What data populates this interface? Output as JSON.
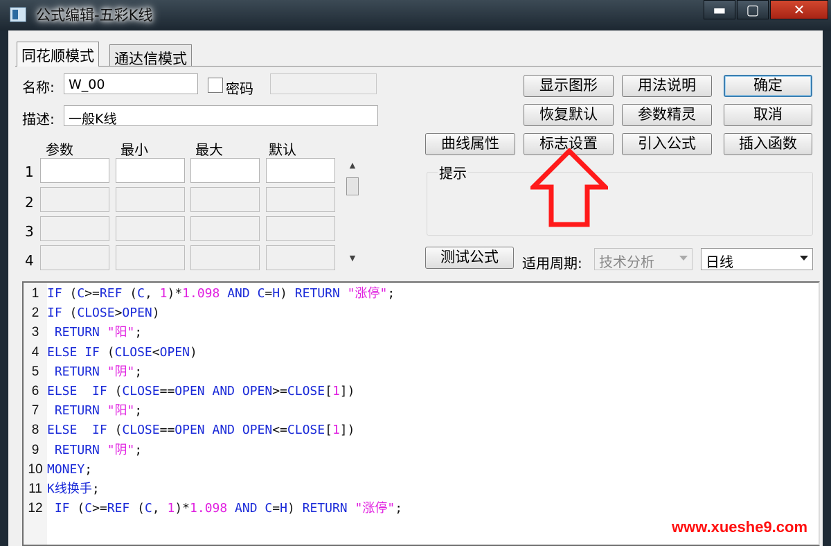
{
  "window": {
    "title": "公式编辑-五彩K线",
    "minimize_icon": "minimize-icon",
    "maximize_icon": "maximize-icon",
    "close_icon": "close-icon"
  },
  "tabs": [
    {
      "label": "同花顺模式",
      "active": true
    },
    {
      "label": "通达信模式",
      "active": false
    }
  ],
  "form": {
    "name_label": "名称:",
    "name_value": "W_00",
    "password_label": "密码",
    "password_checked": false,
    "password_value": "",
    "desc_label": "描述:",
    "desc_value": "一般K线"
  },
  "params": {
    "headers": [
      "参数",
      "最小",
      "最大",
      "默认"
    ],
    "rows": [
      {
        "index": "1",
        "values": [
          "",
          "",
          "",
          ""
        ]
      },
      {
        "index": "2",
        "values": [
          "",
          "",
          "",
          ""
        ]
      },
      {
        "index": "3",
        "values": [
          "",
          "",
          "",
          ""
        ]
      },
      {
        "index": "4",
        "values": [
          "",
          "",
          "",
          ""
        ]
      }
    ]
  },
  "buttons": {
    "show_graph": "显示图形",
    "usage": "用法说明",
    "ok": "确定",
    "restore_default": "恢复默认",
    "param_wizard": "参数精灵",
    "cancel": "取消",
    "curve_props": "曲线属性",
    "flag_settings": "标志设置",
    "import_formula": "引入公式",
    "insert_function": "插入函数",
    "test_formula": "测试公式"
  },
  "hint": {
    "label": "提示",
    "text": ""
  },
  "period": {
    "label": "适用周期:",
    "analysis_value": "技术分析",
    "period_value": "日线"
  },
  "code": [
    {
      "n": "1",
      "tokens": [
        [
          "kw",
          "IF"
        ],
        [
          "op",
          " ("
        ],
        [
          "kw",
          "C"
        ],
        [
          "op",
          ">="
        ],
        [
          "kw",
          "REF"
        ],
        [
          "op",
          " ("
        ],
        [
          "kw",
          "C"
        ],
        [
          "op",
          ", "
        ],
        [
          "num",
          "1"
        ],
        [
          "op",
          ")*"
        ],
        [
          "num",
          "1.098"
        ],
        [
          "op",
          " "
        ],
        [
          "kw",
          "AND"
        ],
        [
          "op",
          " "
        ],
        [
          "kw",
          "C"
        ],
        [
          "op",
          "="
        ],
        [
          "kw",
          "H"
        ],
        [
          "op",
          ") "
        ],
        [
          "kw",
          "RETURN"
        ],
        [
          "op",
          " "
        ],
        [
          "str",
          "\"涨停\""
        ],
        [
          "op",
          ";"
        ]
      ]
    },
    {
      "n": "2",
      "tokens": [
        [
          "kw",
          "IF"
        ],
        [
          "op",
          " ("
        ],
        [
          "kw",
          "CLOSE"
        ],
        [
          "op",
          ">"
        ],
        [
          "kw",
          "OPEN"
        ],
        [
          "op",
          ")"
        ]
      ]
    },
    {
      "n": "3",
      "tokens": [
        [
          "op",
          " "
        ],
        [
          "kw",
          "RETURN"
        ],
        [
          "op",
          " "
        ],
        [
          "str",
          "\"阳\""
        ],
        [
          "op",
          ";"
        ]
      ]
    },
    {
      "n": "4",
      "tokens": [
        [
          "kw",
          "ELSE"
        ],
        [
          "op",
          " "
        ],
        [
          "kw",
          "IF"
        ],
        [
          "op",
          " ("
        ],
        [
          "kw",
          "CLOSE"
        ],
        [
          "op",
          "<"
        ],
        [
          "kw",
          "OPEN"
        ],
        [
          "op",
          ")"
        ]
      ]
    },
    {
      "n": "5",
      "tokens": [
        [
          "op",
          " "
        ],
        [
          "kw",
          "RETURN"
        ],
        [
          "op",
          " "
        ],
        [
          "str",
          "\"阴\""
        ],
        [
          "op",
          ";"
        ]
      ]
    },
    {
      "n": "6",
      "tokens": [
        [
          "kw",
          "ELSE"
        ],
        [
          "op",
          "  "
        ],
        [
          "kw",
          "IF"
        ],
        [
          "op",
          " ("
        ],
        [
          "kw",
          "CLOSE"
        ],
        [
          "op",
          "=="
        ],
        [
          "kw",
          "OPEN"
        ],
        [
          "op",
          " "
        ],
        [
          "kw",
          "AND"
        ],
        [
          "op",
          " "
        ],
        [
          "kw",
          "OPEN"
        ],
        [
          "op",
          ">="
        ],
        [
          "kw",
          "CLOSE"
        ],
        [
          "op",
          "["
        ],
        [
          "num",
          "1"
        ],
        [
          "op",
          "])"
        ]
      ]
    },
    {
      "n": "7",
      "tokens": [
        [
          "op",
          " "
        ],
        [
          "kw",
          "RETURN"
        ],
        [
          "op",
          " "
        ],
        [
          "str",
          "\"阳\""
        ],
        [
          "op",
          ";"
        ]
      ]
    },
    {
      "n": "8",
      "tokens": [
        [
          "kw",
          "ELSE"
        ],
        [
          "op",
          "  "
        ],
        [
          "kw",
          "IF"
        ],
        [
          "op",
          " ("
        ],
        [
          "kw",
          "CLOSE"
        ],
        [
          "op",
          "=="
        ],
        [
          "kw",
          "OPEN"
        ],
        [
          "op",
          " "
        ],
        [
          "kw",
          "AND"
        ],
        [
          "op",
          " "
        ],
        [
          "kw",
          "OPEN"
        ],
        [
          "op",
          "<="
        ],
        [
          "kw",
          "CLOSE"
        ],
        [
          "op",
          "["
        ],
        [
          "num",
          "1"
        ],
        [
          "op",
          "])"
        ]
      ]
    },
    {
      "n": "9",
      "tokens": [
        [
          "op",
          " "
        ],
        [
          "kw",
          "RETURN"
        ],
        [
          "op",
          " "
        ],
        [
          "str",
          "\"阴\""
        ],
        [
          "op",
          ";"
        ]
      ]
    },
    {
      "n": "10",
      "tokens": [
        [
          "kw",
          "MONEY"
        ],
        [
          "op",
          ";"
        ]
      ]
    },
    {
      "n": "11",
      "tokens": [
        [
          "txt",
          "K线换手"
        ],
        [
          "op",
          ";"
        ]
      ]
    },
    {
      "n": "12",
      "tokens": [
        [
          "op",
          " "
        ],
        [
          "kw",
          "IF"
        ],
        [
          "op",
          " ("
        ],
        [
          "kw",
          "C"
        ],
        [
          "op",
          ">="
        ],
        [
          "kw",
          "REF"
        ],
        [
          "op",
          " ("
        ],
        [
          "kw",
          "C"
        ],
        [
          "op",
          ", "
        ],
        [
          "num",
          "1"
        ],
        [
          "op",
          ")*"
        ],
        [
          "num",
          "1.098"
        ],
        [
          "op",
          " "
        ],
        [
          "kw",
          "AND"
        ],
        [
          "op",
          " "
        ],
        [
          "kw",
          "C"
        ],
        [
          "op",
          "="
        ],
        [
          "kw",
          "H"
        ],
        [
          "op",
          ") "
        ],
        [
          "kw",
          "RETURN"
        ],
        [
          "op",
          " "
        ],
        [
          "str",
          "\"涨停\""
        ],
        [
          "op",
          ";"
        ]
      ]
    }
  ],
  "watermark": "www.xueshe9.com",
  "colors": {
    "keyword": "#1a2ad8",
    "string": "#e020e0",
    "arrow": "#ff1a1a",
    "watermark": "#ff1010"
  },
  "annotation_icon": "up-arrow-icon"
}
